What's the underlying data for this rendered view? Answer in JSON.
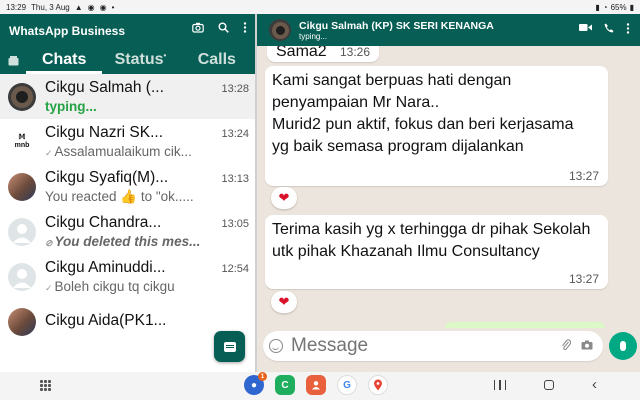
{
  "statusbar": {
    "time": "13:29",
    "date": "Thu, 3 Aug",
    "battery": "65%"
  },
  "app": {
    "title": "WhatsApp Business",
    "tabs": [
      {
        "label": "Chats",
        "active": true
      },
      {
        "label": "Status",
        "dot": "•"
      },
      {
        "label": "Calls"
      }
    ]
  },
  "chats": [
    {
      "name": "Cikgu Salmah (...",
      "time": "13:28",
      "preview": "typing...",
      "avatar": "hijab"
    },
    {
      "name": "Cikgu Nazri SK...",
      "time": "13:24",
      "preview": "Assalamualaikum cik...",
      "avatar": "logo",
      "logo_text": "mnb"
    },
    {
      "name": "Cikgu Syafiq(M)...",
      "time": "13:13",
      "preview": "You reacted 👍 to \"ok.....",
      "avatar": "photo"
    },
    {
      "name": "Cikgu Chandra...",
      "time": "13:05",
      "preview": "You deleted this mes...",
      "avatar": "default"
    },
    {
      "name": "Cikgu Aminuddi...",
      "time": "12:54",
      "preview": "Boleh cikgu tq cikgu",
      "avatar": "default"
    },
    {
      "name": "Cikgu Aida(PK1...",
      "time": "",
      "preview": "",
      "avatar": "photo"
    }
  ],
  "conversation": {
    "contact_name": "Cikgu Salmah (KP) SK SERI KENANGA",
    "contact_status": "typing...",
    "messages": [
      {
        "text": "Sama2",
        "time": "13:26"
      },
      {
        "text": "Kami sangat berpuas hati dengan penyampaian Mr Nara..\nMurid2 pun aktif, fokus dan beri kerjasama yg baik semasa program dijalankan",
        "time": "13:27",
        "reaction": "❤"
      },
      {
        "text": "Terima kasih yg x terhingga dr pihak Sekolah utk pihak Khazanah Ilmu Consultancy",
        "time": "13:27",
        "reaction": "❤"
      }
    ],
    "input_placeholder": "Message"
  },
  "navbar": {
    "badge_count": "1"
  },
  "colors": {
    "brand": "#075e54",
    "accent": "#00a884",
    "typing": "#25a344",
    "chat_bg": "#ece5dd"
  },
  "icons": [
    "camera-icon",
    "search-icon",
    "more-vert-icon",
    "video-call-icon",
    "phone-icon",
    "emoji-icon",
    "attach-icon",
    "mic-icon",
    "new-chat-icon"
  ]
}
